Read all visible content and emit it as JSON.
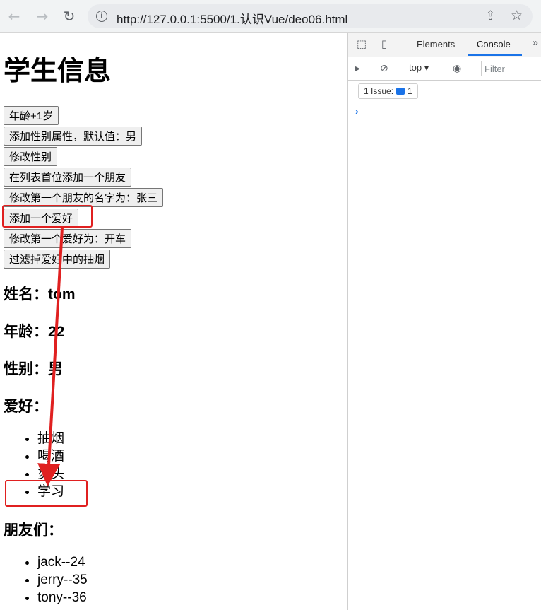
{
  "browser": {
    "url": "http://127.0.0.1:5500/1.认识Vue/deo06.html",
    "back_icon": "←",
    "forward_icon": "→",
    "reload_icon": "↻",
    "share_icon": "⇪",
    "star_icon": "☆"
  },
  "page": {
    "title": "学生信息",
    "buttons": [
      "年龄+1岁",
      "添加性别属性，默认值：男",
      "修改性别",
      "在列表首位添加一个朋友",
      "修改第一个朋友的名字为：张三",
      "添加一个爱好",
      "修改第一个爱好为：开车",
      "过滤掉爱好中的抽烟"
    ],
    "name_line": "姓名：tom",
    "age_line": "年龄：22",
    "gender_line": "性别：男",
    "hobby_heading": "爱好：",
    "hobbies": [
      "抽烟",
      "喝酒",
      "烫头",
      "学习"
    ],
    "friends_heading": "朋友们：",
    "friends": [
      "jack--24",
      "jerry--35",
      "tony--36"
    ]
  },
  "devtools": {
    "tabs": [
      "Elements",
      "Console"
    ],
    "active_tab": "Console",
    "context": "top",
    "filter_placeholder": "Filter",
    "issues_label": "1 Issue:",
    "issues_count": "1",
    "prompt": "›"
  },
  "colors": {
    "annotation": "#e02020",
    "accent": "#1a73e8"
  }
}
